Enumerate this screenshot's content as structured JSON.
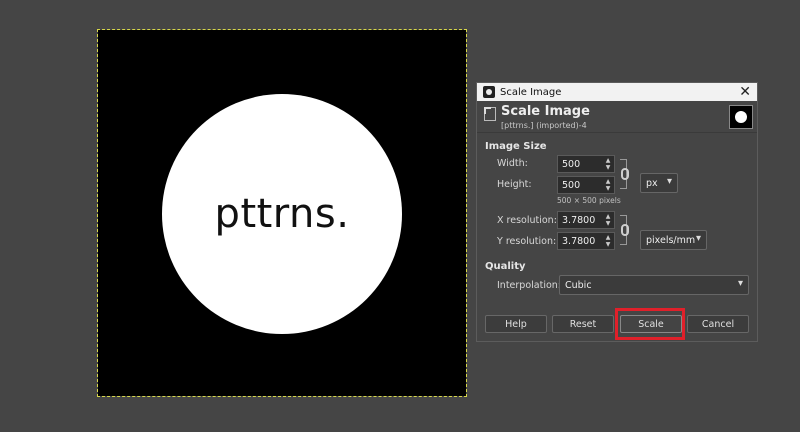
{
  "canvas": {
    "image_text": "pttrns."
  },
  "dialog": {
    "window_title": "Scale Image",
    "header_title": "Scale Image",
    "header_subtitle": "[pttrns.] (imported)-4",
    "image_size_title": "Image Size",
    "width_label": "Width:",
    "width_value": "500",
    "height_label": "Height:",
    "height_value": "500",
    "size_hint": "500 × 500 pixels",
    "unit_value": "px",
    "x_res_label": "X resolution:",
    "x_res_value": "3.7800",
    "y_res_label": "Y resolution:",
    "y_res_value": "3.7800",
    "res_unit_value": "pixels/mm",
    "quality_title": "Quality",
    "interp_label": "Interpolation:",
    "interp_value": "Cubic",
    "buttons": {
      "help": "Help",
      "reset": "Reset",
      "scale": "Scale",
      "cancel": "Cancel"
    }
  },
  "colors": {
    "highlight": "#e0202a",
    "selection_outline": "#d8d84a"
  }
}
